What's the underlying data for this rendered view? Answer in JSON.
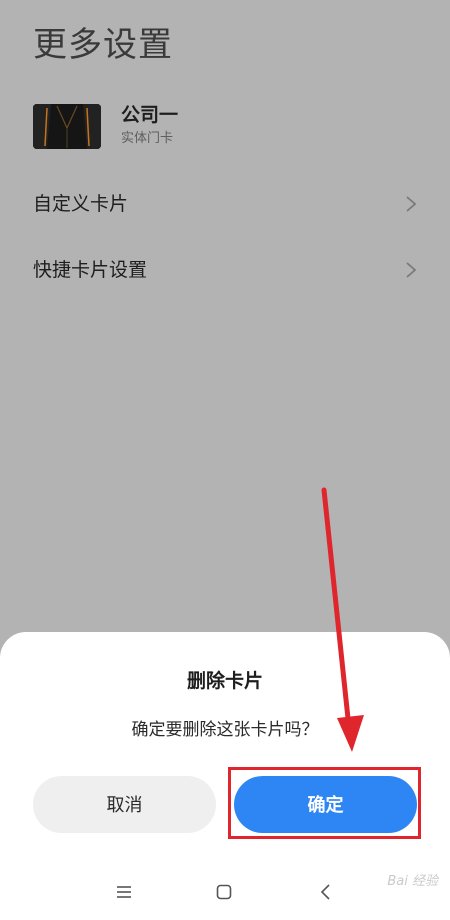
{
  "page": {
    "title": "更多设置"
  },
  "card": {
    "name": "公司一",
    "subtitle": "实体门卡"
  },
  "settings": [
    {
      "label": "自定义卡片"
    },
    {
      "label": "快捷卡片设置"
    }
  ],
  "dialog": {
    "title": "删除卡片",
    "message": "确定要删除这张卡片吗？",
    "cancel_label": "取消",
    "confirm_label": "确定"
  },
  "navbar": {
    "icons": [
      "menu-icon",
      "home-icon",
      "back-icon"
    ]
  },
  "watermark": {
    "text": "Bai 经验"
  },
  "colors": {
    "accent": "#2e86f5",
    "annotation": "#e0262d",
    "overlay": "#b3b3b3"
  }
}
